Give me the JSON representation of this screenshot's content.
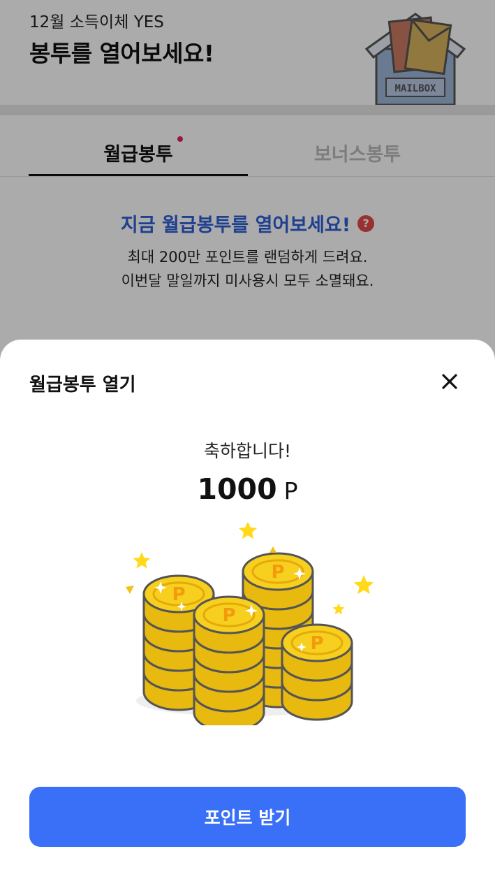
{
  "header": {
    "subtitle": "12월 소득이체 YES",
    "title": "봉투를 열어보세요!",
    "mailbox_label": "MAILBOX"
  },
  "tabs": [
    {
      "label": "월급봉투",
      "active": true,
      "has_dot": true
    },
    {
      "label": "보너스봉투",
      "active": false
    }
  ],
  "promo": {
    "headline": "지금 월급봉투를 열어보세요!",
    "help_icon": "?",
    "line1": "최대 200만 포인트를 랜덤하게 드려요.",
    "line2": "이번달 말일까지 미사용시 모두 소멸돼요."
  },
  "sheet": {
    "title": "월급봉투 열기",
    "close_icon": "close-icon",
    "congrats": "축하합니다!",
    "amount_value": "1000",
    "amount_unit": "P",
    "coin_label": "P",
    "button_label": "포인트 받기"
  },
  "colors": {
    "accent_blue": "#3a6ff7",
    "headline_blue": "#2f5fd6",
    "tab_dot": "#e0245e",
    "coin_yellow": "#f7cf1f",
    "star_yellow": "#ffd91a"
  }
}
